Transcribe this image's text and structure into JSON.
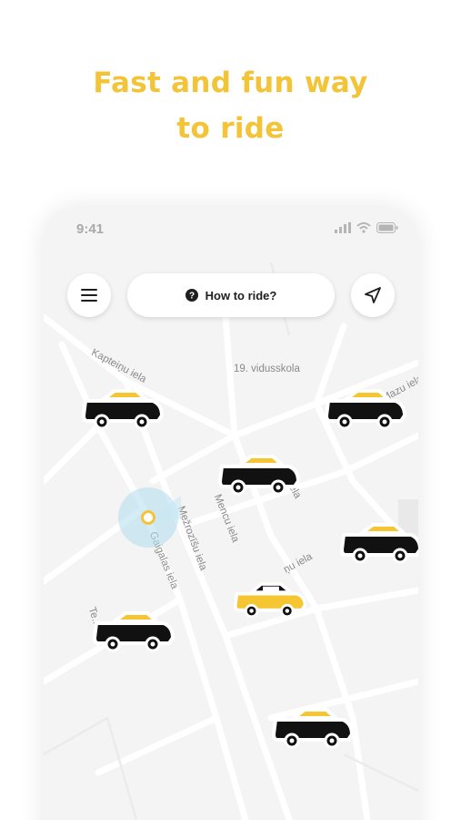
{
  "headline": {
    "line1": "Fast and fun way",
    "line2": "to ride"
  },
  "status_bar": {
    "time": "9:41",
    "icons": [
      "signal-icon",
      "wifi-icon",
      "battery-icon"
    ]
  },
  "toolbar": {
    "menu_icon": "hamburger-menu-icon",
    "how_to_ride_label": "How to ride?",
    "help_icon": "question-circle-icon",
    "locate_icon": "navigation-arrow-icon"
  },
  "map": {
    "streets": [
      "Kapteiņu iela",
      "19. vidusskola",
      "Mazu iela",
      "Mencu iela",
      "Mežrozīšu iela",
      "Gaigalas iela",
      "Te... iela",
      "ņu iela",
      "ela"
    ],
    "cars": [
      {
        "name": "taxi-car-1",
        "style": "black-body-yellow-roof"
      },
      {
        "name": "taxi-car-2",
        "style": "black-body-yellow-roof"
      },
      {
        "name": "taxi-car-3",
        "style": "black-body-yellow-roof"
      },
      {
        "name": "taxi-car-4",
        "style": "black-body-yellow-roof"
      },
      {
        "name": "taxi-car-5",
        "style": "yellow-body-black-roof"
      },
      {
        "name": "taxi-car-6",
        "style": "black-body-yellow-roof"
      },
      {
        "name": "taxi-car-7",
        "style": "black-body-yellow-roof"
      }
    ]
  },
  "colors": {
    "accent": "#f3c437",
    "map_background": "#f4f4f4",
    "road": "#ffffff",
    "car_black": "#111111",
    "car_yellow": "#f6c532",
    "location_halo": "#bfe3ef"
  }
}
